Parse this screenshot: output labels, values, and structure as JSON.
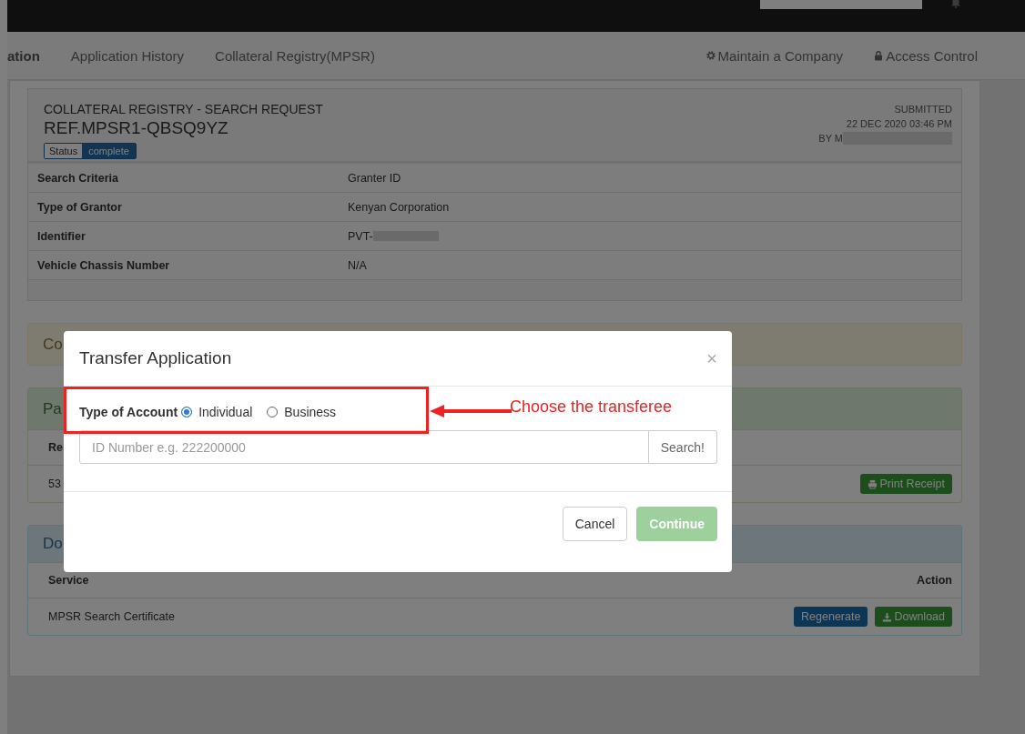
{
  "nav": {
    "left": [
      {
        "label": "ation"
      },
      {
        "label": "Application History"
      },
      {
        "label": "Collateral Registry(MPSR)"
      }
    ],
    "right": [
      {
        "label": "Maintain a Company"
      },
      {
        "label": "Access Control"
      }
    ]
  },
  "request": {
    "title": "COLLATERAL REGISTRY - SEARCH REQUEST",
    "ref": "REF.MPSR1-QBSQ9YZ",
    "status_label": "Status",
    "status": "complete",
    "submitted_label": "SUBMITTED",
    "submitted_at": "22 DEC 2020 03:46 PM",
    "by": "BY M"
  },
  "details": [
    {
      "label": "Search Criteria",
      "value": "Granter ID",
      "redacted": false
    },
    {
      "label": "Type of Grantor",
      "value": "Kenyan Corporation",
      "redacted": false
    },
    {
      "label": "Identifier",
      "value": "PVT-",
      "redacted": true
    },
    {
      "label": "Vehicle Chassis Number",
      "value": "N/A",
      "redacted": false
    }
  ],
  "panels": [
    {
      "kind": "warning",
      "title": "Co"
    },
    {
      "kind": "success",
      "title": "Pa",
      "header": [
        "Re"
      ],
      "rows": [
        {
          "cell": "53",
          "buttons": [
            {
              "label": "Print Receipt",
              "kind": "print"
            }
          ]
        }
      ]
    },
    {
      "kind": "info",
      "title": "Do",
      "header": [
        "Service",
        "Action"
      ],
      "rows": [
        {
          "cell": "MPSR Search Certificate",
          "buttons": [
            {
              "label": "Regenerate",
              "kind": "primary"
            },
            {
              "label": "Download",
              "kind": "success"
            }
          ]
        }
      ]
    }
  ],
  "modal": {
    "title": "Transfer Application",
    "close": "×",
    "account_label": "Type of Account",
    "options": [
      {
        "label": "Individual",
        "selected": true
      },
      {
        "label": "Business",
        "selected": false
      }
    ],
    "search": {
      "placeholder": "ID Number e.g. 222200000",
      "button": "Search!"
    },
    "buttons": [
      {
        "label": "Cancel",
        "kind": "default",
        "disabled": false
      },
      {
        "label": "Continue",
        "kind": "success",
        "disabled": true
      }
    ]
  },
  "annotation": {
    "text": "Choose the transferee"
  }
}
